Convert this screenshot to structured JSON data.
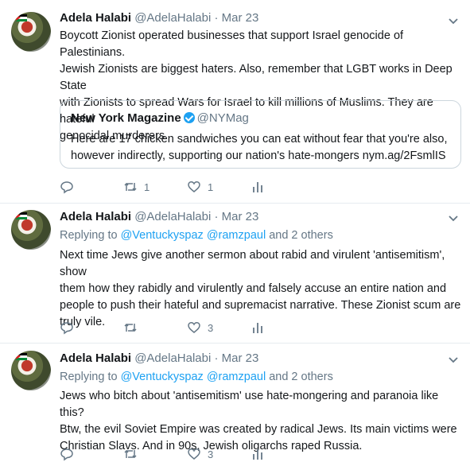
{
  "tweets": [
    {
      "name": "Adela Halabi",
      "handle": "@AdelaHalabi",
      "dot": "·",
      "date": "Mar 23",
      "replying_prefix": "",
      "lines": [
        "Boycott Zionist operated businesses that support Israel genocide of   Palestinians.",
        "Jewish Zionists are biggest haters. Also, remember that   LGBT works in Deep State",
        "with Zionists to spread Wars for Israel to kill   millions of Muslims. They are hateful",
        "genocidal murderers."
      ],
      "quote": {
        "name": "New York Magazine",
        "handle": "@NYMag",
        "lines": [
          "Here are 17 chicken sandwiches you can eat without fear that you're also,",
          "however indirectly, supporting our nation's hate-mongers nym.ag/2FsmlIS"
        ]
      },
      "retweets": "1",
      "likes": "1",
      "replies": ""
    },
    {
      "name": "Adela Halabi",
      "handle": "@AdelaHalabi",
      "dot": "·",
      "date": "Mar 23",
      "replying_prefix": "Replying to",
      "mention1": "@Ventuckyspaz",
      "mention2": "@ramzpaul",
      "replying_suffix": "and 2 others",
      "lines": [
        "Next time Jews give another sermon about rabid and virulent 'antisemitism', show",
        "them how they rabidly and virulently and falsely accuse an entire nation and",
        "people to push their hateful and supremacist narrative. These Zionist scum are",
        "truly vile."
      ],
      "retweets": "",
      "likes": "3",
      "replies": ""
    },
    {
      "name": "Adela Halabi",
      "handle": "@AdelaHalabi",
      "dot": "·",
      "date": "Mar 23",
      "replying_prefix": "Replying to",
      "mention1": "@Ventuckyspaz",
      "mention2": "@ramzpaul",
      "replying_suffix": "and 2 others",
      "lines": [
        "Jews who bitch about 'antisemitism' use hate-mongering and paranoia like this?",
        "Btw, the evil Soviet Empire was created by radical Jews. Its main victims were",
        "Christian Slavs. And in 90s, Jewish oligarchs raped Russia."
      ],
      "retweets": "",
      "likes": "3",
      "replies": ""
    }
  ],
  "colors": {
    "link": "#1da1f2",
    "muted": "#657786",
    "text": "#14171a",
    "border": "#e6ecf0"
  },
  "icons": [
    "chevron-down-icon",
    "reply-icon",
    "retweet-icon",
    "like-icon",
    "analytics-icon",
    "verified-badge-icon"
  ]
}
